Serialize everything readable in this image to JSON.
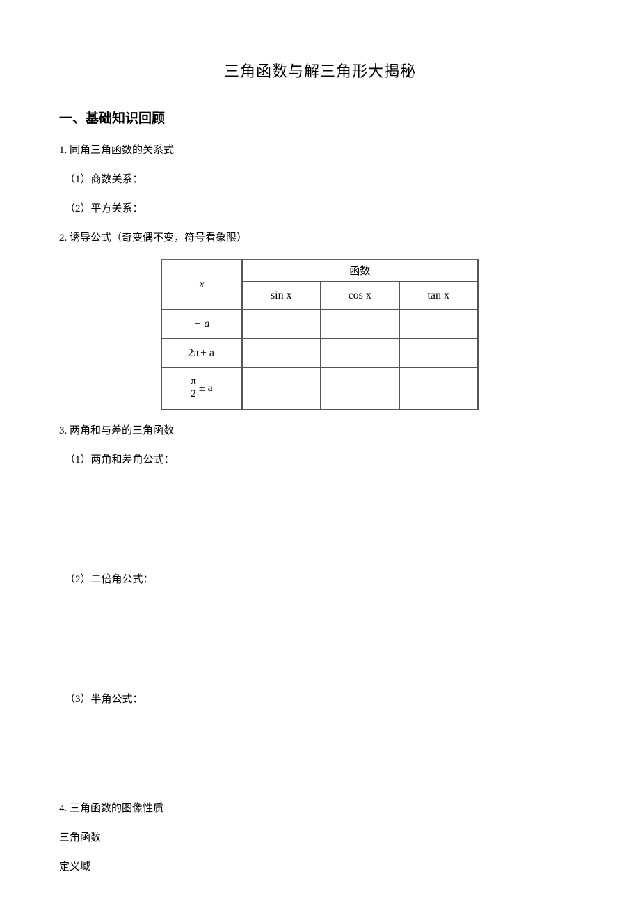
{
  "title": "三角函数与解三角形大揭秘",
  "section1": {
    "heading": "一、基础知识回顾",
    "item1": {
      "label": "1. 同角三角函数的关系式",
      "sub1": "（1）商数关系：",
      "sub2": "（2）平方关系："
    },
    "item2": {
      "label": "2. 诱导公式（奇变偶不变，符号看象限）",
      "table": {
        "xhdr": "x",
        "funhdr": "函数",
        "col1": "sin x",
        "col2": "cos x",
        "col3": "tan x",
        "r1": "− a",
        "r2_a": "2π",
        "r2_b": "± a",
        "r3_num": "π",
        "r3_den": "2",
        "r3_tail": "± a"
      }
    },
    "item3": {
      "label": "3. 两角和与差的三角函数",
      "sub1": "（1）两角和差角公式：",
      "sub2": "（2）二倍角公式：",
      "sub3": "（3）半角公式："
    },
    "item4": {
      "label": "4. 三角函数的图像性质",
      "r1": "三角函数",
      "r2": "定义域"
    }
  }
}
